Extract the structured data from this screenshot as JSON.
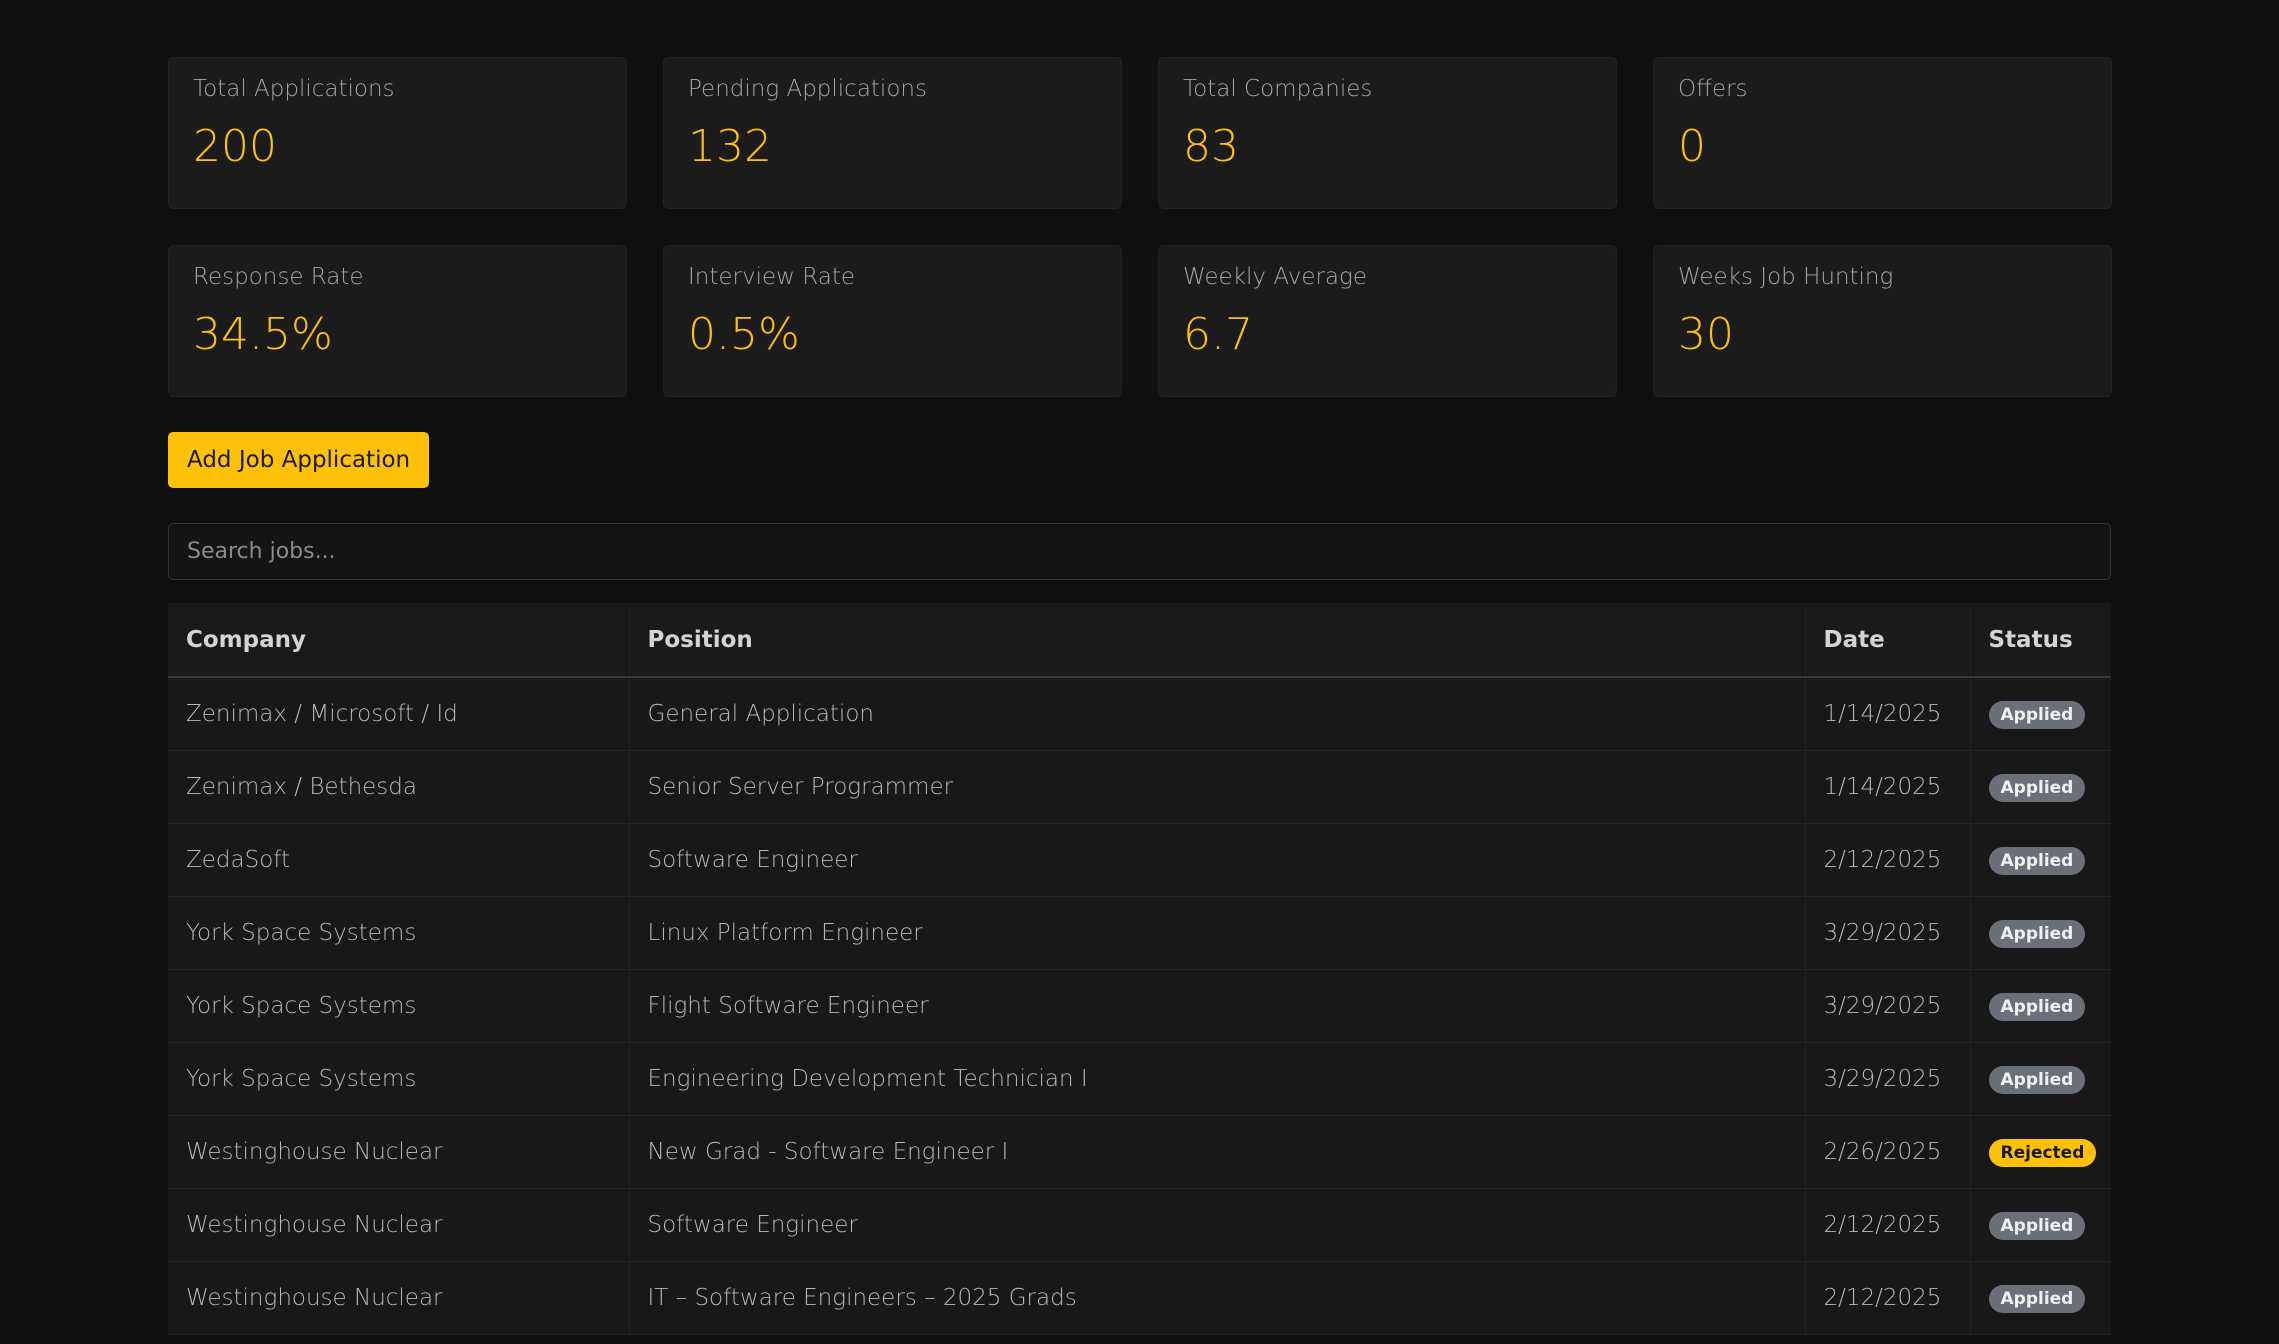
{
  "stats": [
    {
      "label": "Total Applications",
      "value": "200"
    },
    {
      "label": "Pending Applications",
      "value": "132"
    },
    {
      "label": "Total Companies",
      "value": "83"
    },
    {
      "label": "Offers",
      "value": "0"
    },
    {
      "label": "Response Rate",
      "value": "34.5%"
    },
    {
      "label": "Interview Rate",
      "value": "0.5%"
    },
    {
      "label": "Weekly Average",
      "value": "6.7"
    },
    {
      "label": "Weeks Job Hunting",
      "value": "30"
    }
  ],
  "actions": {
    "add_label": "Add Job Application"
  },
  "search": {
    "placeholder": "Search jobs...",
    "value": ""
  },
  "table": {
    "columns": [
      "Company",
      "Position",
      "Date",
      "Status"
    ],
    "rows": [
      {
        "company": "Zenimax / Microsoft / Id",
        "position": "General Application",
        "date": "1/14/2025",
        "status": "Applied"
      },
      {
        "company": "Zenimax / Bethesda",
        "position": "Senior Server Programmer",
        "date": "1/14/2025",
        "status": "Applied"
      },
      {
        "company": "ZedaSoft",
        "position": "Software Engineer",
        "date": "2/12/2025",
        "status": "Applied"
      },
      {
        "company": "York Space Systems",
        "position": "Linux Platform Engineer",
        "date": "3/29/2025",
        "status": "Applied"
      },
      {
        "company": "York Space Systems",
        "position": "Flight Software Engineer",
        "date": "3/29/2025",
        "status": "Applied"
      },
      {
        "company": "York Space Systems",
        "position": "Engineering Development Technician I",
        "date": "3/29/2025",
        "status": "Applied"
      },
      {
        "company": "Westinghouse Nuclear",
        "position": "New Grad - Software Engineer I",
        "date": "2/26/2025",
        "status": "Rejected"
      },
      {
        "company": "Westinghouse Nuclear",
        "position": "Software Engineer",
        "date": "2/12/2025",
        "status": "Applied"
      },
      {
        "company": "Westinghouse Nuclear",
        "position": "IT – Software Engineers – 2025 Grads",
        "date": "2/12/2025",
        "status": "Applied"
      }
    ]
  },
  "colors": {
    "accent": "#ffc107",
    "background": "#101010",
    "card": "#1b1b1b",
    "badge_applied": "#6b7078",
    "badge_rejected": "#ffc107"
  }
}
